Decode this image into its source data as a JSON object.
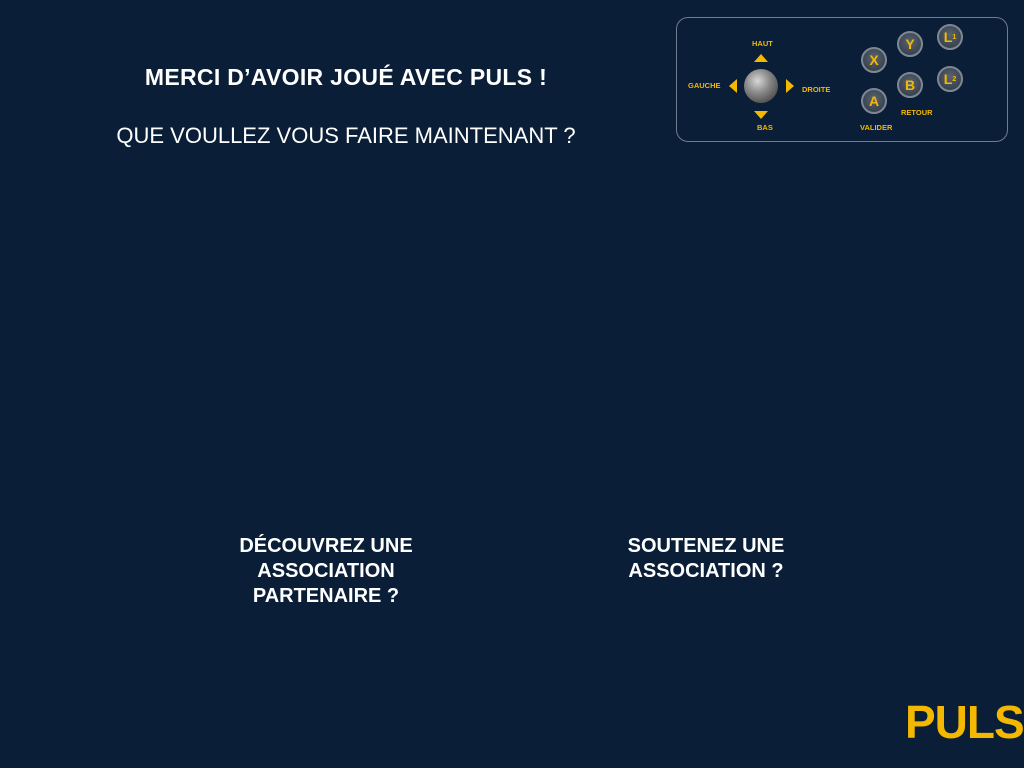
{
  "title": "MERCI D’AVOIR JOUÉ AVEC PULS !",
  "subtitle": "QUE VOULLEZ VOUS FAIRE MAINTENANT ?",
  "controls": {
    "up": "HAUT",
    "down": "BAS",
    "left": "GAUCHE",
    "right": "DROITE",
    "validate": "VALIDER",
    "back": "RETOUR",
    "buttons": {
      "x": "X",
      "y": "Y",
      "a": "A",
      "b": "B",
      "l": "L",
      "l1": "1",
      "l2": "2"
    }
  },
  "options": {
    "discover": "DÉCOUVREZ UNE ASSOCIATION PARTENAIRE ?",
    "support": "SOUTENEZ UNE ASSOCIATION ?"
  },
  "logo": "PULS",
  "colors": {
    "background": "#0a1e37",
    "accent": "#f5b800",
    "text": "#ffffff"
  }
}
